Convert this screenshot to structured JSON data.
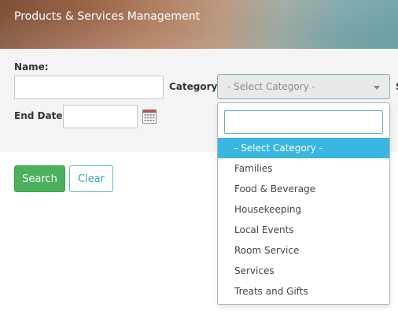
{
  "header": {
    "title": "Products & Services Management"
  },
  "filters": {
    "name_label": "Name:",
    "name_value": "",
    "category_label": "Category:",
    "category_selected": "- Select Category -",
    "end_date_label": "End Date:",
    "end_date_value": "",
    "cut_off_label": "S"
  },
  "buttons": {
    "search_label": "Search",
    "clear_label": "Clear"
  },
  "dropdown": {
    "search_value": "",
    "options": [
      {
        "label": "- Select Category -",
        "selected": true
      },
      {
        "label": "Families"
      },
      {
        "label": "Food & Beverage"
      },
      {
        "label": "Housekeeping"
      },
      {
        "label": "Local Events"
      },
      {
        "label": "Room Service"
      },
      {
        "label": "Services"
      },
      {
        "label": "Treats and Gifts"
      }
    ]
  },
  "colors": {
    "search_button": "#4cb15c",
    "clear_button_border": "#5cb3c5",
    "highlight": "#3ab6e0",
    "panel_background": "#f4f4f4"
  },
  "icons": {
    "calendar": "calendar-icon",
    "caret": "chevron-down-icon"
  }
}
